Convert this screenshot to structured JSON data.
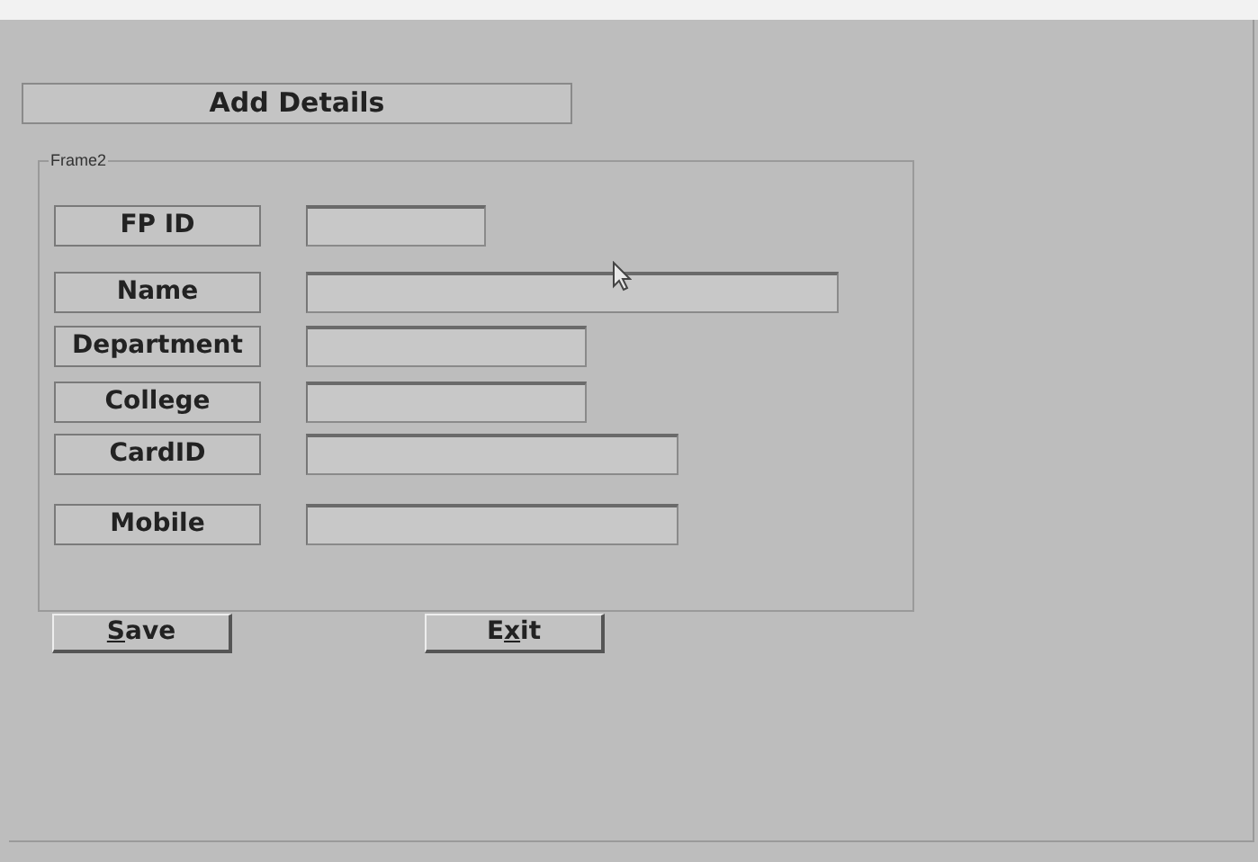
{
  "header": {
    "title": "Add Details"
  },
  "frame": {
    "caption": "Frame2",
    "fields": [
      {
        "label": "FP ID"
      },
      {
        "label": "Name"
      },
      {
        "label": "Department"
      },
      {
        "label": "College"
      },
      {
        "label": "CardID"
      },
      {
        "label": "Mobile"
      }
    ]
  },
  "buttons": [
    {
      "parts": [
        {
          "text": "S",
          "underlined": true
        },
        {
          "text": "ave",
          "underlined": false
        }
      ]
    },
    {
      "parts": [
        {
          "text": "E",
          "underlined": false
        },
        {
          "text": "x",
          "underlined": true
        },
        {
          "text": "it",
          "underlined": false
        }
      ]
    }
  ]
}
